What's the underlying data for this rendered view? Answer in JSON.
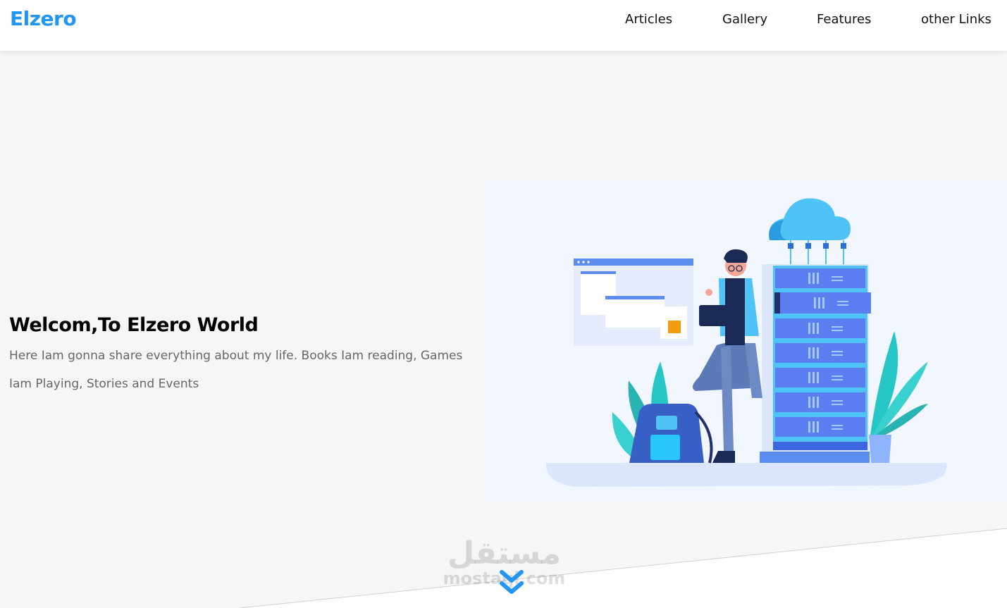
{
  "header": {
    "logo": "Elzero",
    "nav": [
      {
        "label": "Articles"
      },
      {
        "label": "Gallery"
      },
      {
        "label": "Features"
      },
      {
        "label": "other Links"
      }
    ]
  },
  "hero": {
    "title": "Welcom,To Elzero World",
    "text": "Here Iam gonna share everything about my life. Books Iam reading, Games Iam Playing, Stories and Events"
  },
  "watermark": {
    "arabic": "مستقل",
    "latin": "mostaql.com"
  },
  "colors": {
    "brand": "#2196f3",
    "background": "#f6f6f6",
    "illustration_bg": "#f2f6fe",
    "server_blue": "#4f7cf0",
    "cloud_blue": "#4fc3f7",
    "plant_teal": "#26c6c6"
  },
  "icons": {
    "scroll": "double-chevron-down-icon"
  }
}
